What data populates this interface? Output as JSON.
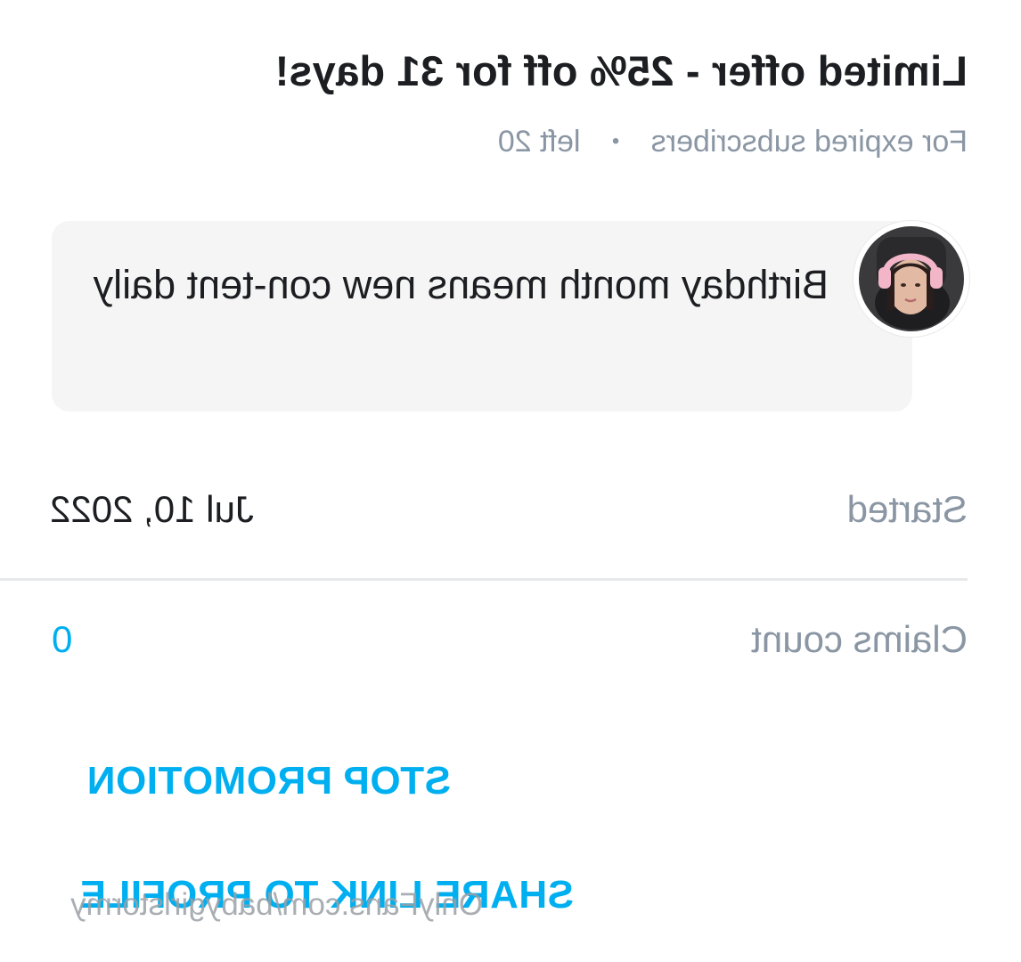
{
  "offer": {
    "title": "Limited offer - 25% off for 31 days!",
    "audience": "For expired subscribers",
    "separator": "•",
    "remaining": "left 20"
  },
  "message": {
    "avatar_icon": "creator-avatar-icon",
    "text": "Birthday month means new con-tent daily"
  },
  "details": {
    "started_label": "Started",
    "started_value": "Jul 10, 2022",
    "claims_label": "Claims count",
    "claims_value": "0"
  },
  "actions": {
    "stop_label": "STOP PROMOTION",
    "share_label": "SHARE LINK TO PROFILE"
  },
  "watermark": "OnlyFans.com/babygirlstormy",
  "colors": {
    "accent": "#00aff0",
    "text": "#1c1e21",
    "muted": "#8a96a3",
    "bubble": "#f5f5f6",
    "divider": "#e6e8ea"
  }
}
